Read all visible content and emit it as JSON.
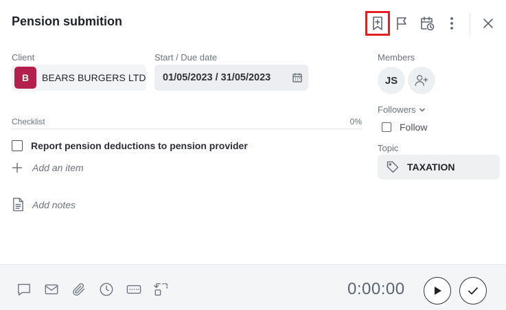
{
  "task": {
    "title": "Pension submition"
  },
  "header": {
    "icons": [
      "add-bookmark-icon",
      "flag-icon",
      "calendar-clock-icon",
      "more-vertical-icon",
      "close-icon"
    ]
  },
  "client": {
    "label": "Client",
    "badge": "B",
    "name": "BEARS BURGERS LTD",
    "badge_color": "#b3204b"
  },
  "dates": {
    "label": "Start / Due date",
    "value": "01/05/2023 / 31/05/2023"
  },
  "checklist": {
    "label": "Checklist",
    "percent": "0%",
    "items": [
      {
        "text": "Report pension deductions to pension provider",
        "checked": false
      }
    ],
    "add_item": "Add an item"
  },
  "notes": {
    "placeholder": "Add notes"
  },
  "members": {
    "label": "Members",
    "list": [
      {
        "initials": "JS"
      }
    ]
  },
  "followers": {
    "label": "Followers",
    "follow_label": "Follow"
  },
  "topic": {
    "label": "Topic",
    "value": "TAXATION"
  },
  "footer": {
    "timer": "0:00:00",
    "icons": [
      "comment-icon",
      "mail-icon",
      "attachment-icon",
      "clock-icon",
      "keyboard-icon",
      "convert-icon",
      "play-icon",
      "check-icon"
    ]
  },
  "colors": {
    "highlight": "#e32020",
    "accent_badge": "#b3204b"
  }
}
